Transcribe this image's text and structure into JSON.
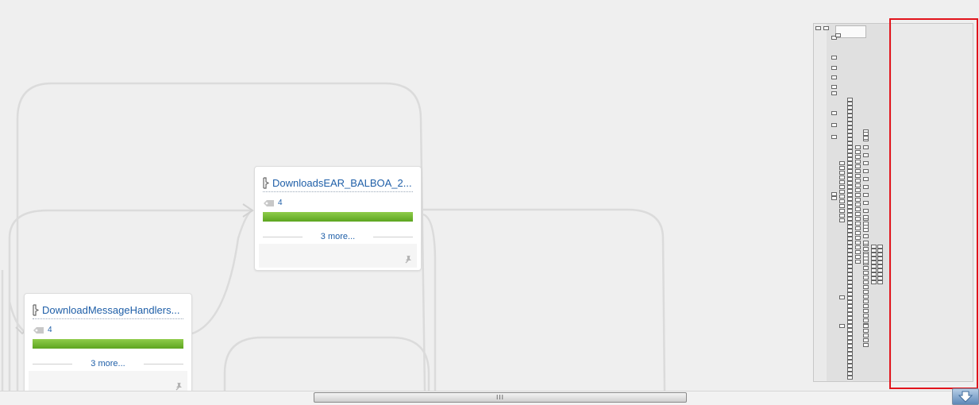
{
  "canvas": {
    "nodes": [
      {
        "name": "DownloadsEAR_BALBOA_2...",
        "count": "4",
        "progress": 1.0,
        "more_label": "3 more..."
      },
      {
        "name": "DownloadMessageHandlers...",
        "count": "4",
        "progress": 1.0,
        "more_label": "3 more..."
      }
    ]
  },
  "icons": {
    "node": "package-icon",
    "count": "tag-icon",
    "pin": "pin-icon",
    "scroll_grip": "grip-icon",
    "corner": "download-arrow-icon"
  },
  "colors": {
    "link": "#1f5fa8",
    "progress": "#6cb82c",
    "highlight": "#e2141c"
  },
  "scrollbar": {
    "grip": "III"
  }
}
